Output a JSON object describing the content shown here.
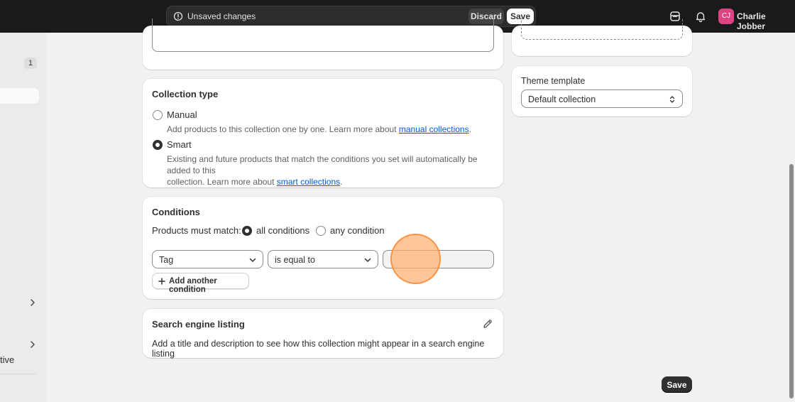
{
  "topbar": {
    "unsaved_text": "Unsaved changes",
    "discard_label": "Discard",
    "save_label": "Save",
    "avatar_initials": "CJ",
    "user_name": "Charlie Jobber",
    "icons": [
      "alert-circle-icon",
      "store-icon",
      "bell-icon"
    ]
  },
  "sidebar": {
    "count_badge": "1",
    "partial_item_text": "tive"
  },
  "collection_type": {
    "title": "Collection type",
    "manual_label": "Manual",
    "manual_help_prefix": "Add products to this collection one by one. Learn more about ",
    "manual_help_link": "manual collections",
    "manual_help_suffix": ".",
    "smart_label": "Smart",
    "smart_help_line1": "Existing and future products that match the conditions you set will automatically be added to this",
    "smart_help_prefix": "collection. Learn more about ",
    "smart_help_link": "smart collections",
    "smart_help_suffix": ".",
    "selected": "Smart"
  },
  "conditions": {
    "title": "Conditions",
    "match_label": "Products must match:",
    "all_label": "all conditions",
    "any_label": "any condition",
    "selected_match": "all conditions",
    "field_value": "Tag",
    "operator_value": "is equal to",
    "value_input": "",
    "add_button_label": "Add another condition"
  },
  "seo": {
    "title": "Search engine listing",
    "description": "Add a title and description to see how this collection might appear in a search engine listing"
  },
  "theme": {
    "label": "Theme template",
    "value": "Default collection"
  },
  "footer": {
    "save_label": "Save"
  },
  "colors": {
    "topbar_bg": "#1a1a1a",
    "link": "#005bd3",
    "primary_button": "#303030",
    "avatar": "#e04383"
  }
}
